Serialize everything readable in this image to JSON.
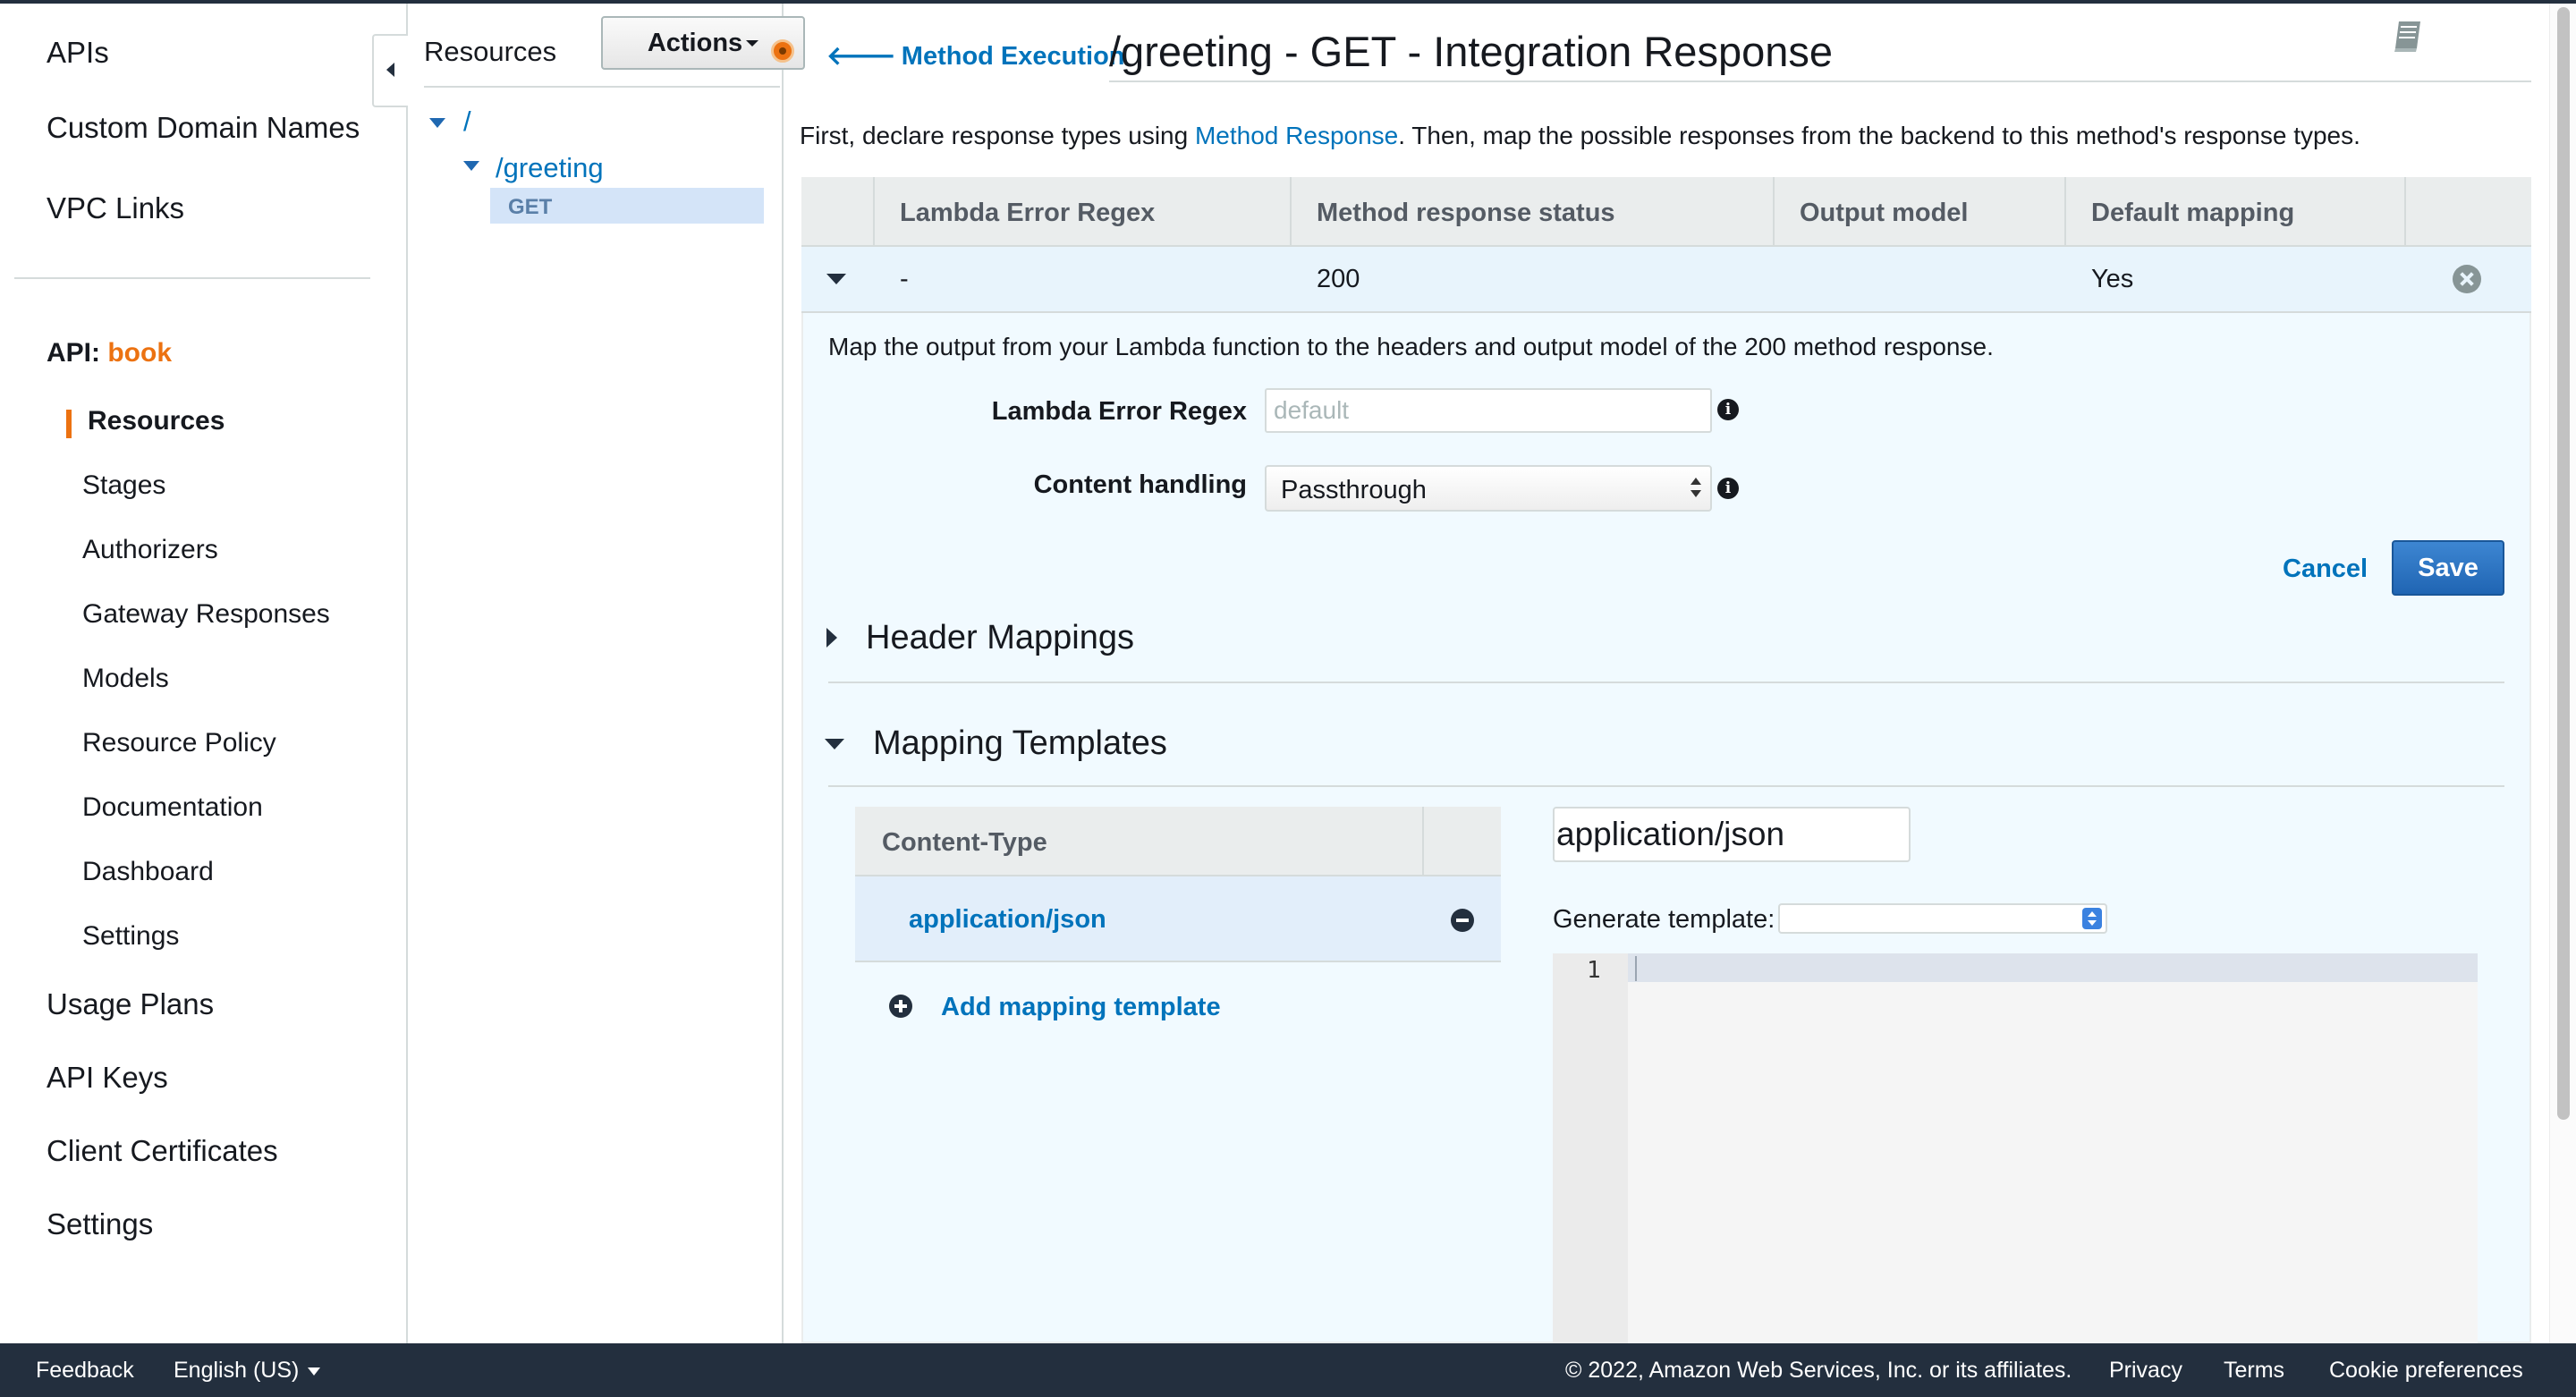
{
  "left_nav": {
    "top_items": [
      "APIs",
      "Custom Domain Names",
      "VPC Links"
    ],
    "api_prefix": "API:",
    "api_name": "book",
    "sub_items": [
      "Resources",
      "Stages",
      "Authorizers",
      "Gateway Responses",
      "Models",
      "Resource Policy",
      "Documentation",
      "Dashboard",
      "Settings"
    ],
    "bottom_items": [
      "Usage Plans",
      "API Keys",
      "Client Certificates",
      "Settings"
    ]
  },
  "resources_pane": {
    "title": "Resources",
    "actions_label": "Actions",
    "tree": {
      "root": "/",
      "child": "/greeting",
      "method": "GET"
    }
  },
  "header": {
    "back_link": "Method Execution",
    "title": "/greeting - GET - Integration Response"
  },
  "intro": {
    "before": "First, declare response types using ",
    "link": "Method Response",
    "after": ". Then, map the possible responses from the backend to this method's response types."
  },
  "response_table": {
    "columns": [
      "Lambda Error Regex",
      "Method response status",
      "Output model",
      "Default mapping"
    ],
    "row": {
      "regex": "-",
      "status": "200",
      "output_model": "",
      "default_mapping": "Yes"
    }
  },
  "detail": {
    "description": "Map the output from your Lambda function to the headers and output model of the 200 method response.",
    "regex_label": "Lambda Error Regex",
    "regex_placeholder": "default",
    "content_handling_label": "Content handling",
    "content_handling_value": "Passthrough",
    "cancel_label": "Cancel",
    "save_label": "Save"
  },
  "sections": {
    "header_mappings": "Header Mappings",
    "mapping_templates": "Mapping Templates"
  },
  "mapping_templates": {
    "column": "Content-Type",
    "items": [
      "application/json"
    ],
    "add_label": "Add mapping template",
    "content_type_value": "application/json",
    "generate_label": "Generate template:",
    "generate_value": "",
    "editor_line": "1"
  },
  "footer": {
    "feedback": "Feedback",
    "language": "English (US)",
    "copyright": "© 2022, Amazon Web Services, Inc. or its affiliates.",
    "privacy": "Privacy",
    "terms": "Terms",
    "cookies": "Cookie preferences"
  },
  "colors": {
    "accent_orange": "#ec7211",
    "link_blue": "#0073bb",
    "footer_bg": "#232f3e",
    "save_button": "#2a72c5"
  }
}
